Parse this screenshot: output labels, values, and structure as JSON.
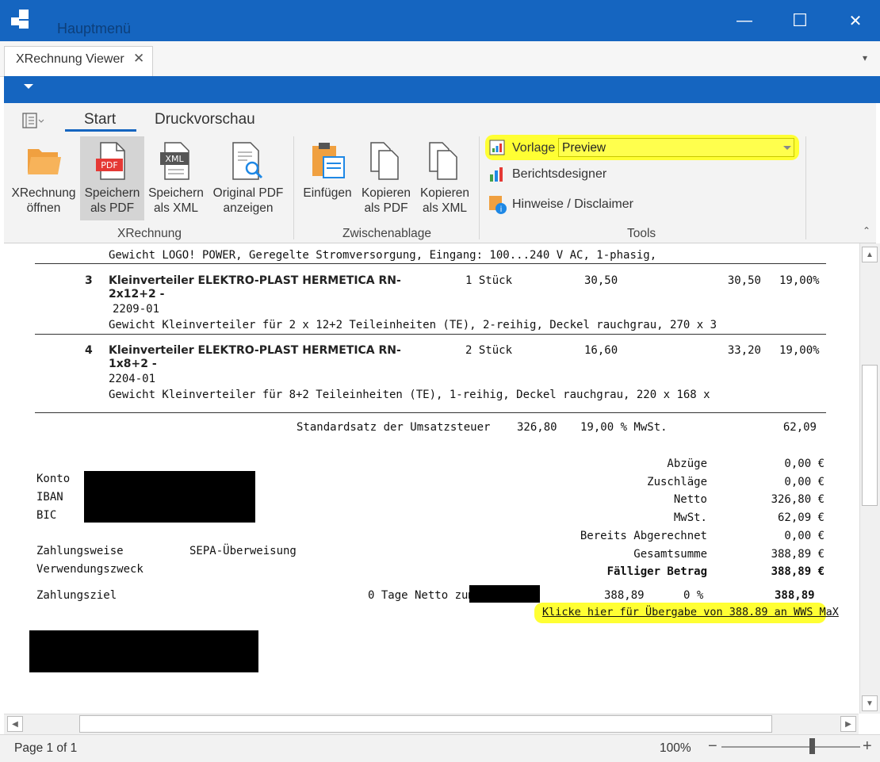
{
  "window": {
    "title": "Hauptmenü",
    "controls": {
      "minimize": "—",
      "maximize": "☐",
      "close": "✕"
    }
  },
  "tab": {
    "label": "XRechnung Viewer",
    "close": "✕",
    "overflow": "▾"
  },
  "ribbon": {
    "tabs": {
      "start": "Start",
      "print_preview": "Druckvorschau"
    },
    "groups": {
      "xrechnung": {
        "label": "XRechnung",
        "buttons": {
          "open": {
            "line1": "XRechnung",
            "line2": "öffnen"
          },
          "save_pdf": {
            "line1": "Speichern",
            "line2": "als PDF"
          },
          "save_xml": {
            "line1": "Speichern",
            "line2": "als XML"
          },
          "show_pdf": {
            "line1": "Original PDF",
            "line2": "anzeigen"
          }
        }
      },
      "clipboard": {
        "label": "Zwischenablage",
        "buttons": {
          "paste": {
            "line1": "Einfügen"
          },
          "copy_pdf": {
            "line1": "Kopieren",
            "line2": "als PDF"
          },
          "copy_xml": {
            "line1": "Kopieren",
            "line2": "als XML"
          }
        }
      },
      "tools": {
        "label": "Tools",
        "template_label": "Vorlage",
        "template_value": "Preview",
        "report_designer": "Berichtsdesigner",
        "notes": "Hinweise / Disclaimer"
      }
    }
  },
  "document": {
    "prev_item_desc": "Gewicht LOGO! POWER, Geregelte Stromversorgung, Eingang: 100...240 V AC, 1-phasig,",
    "items": [
      {
        "pos": "3",
        "title1": "Kleinverteiler ELEKTRO-PLAST HERMETICA RN-",
        "title2": "2x12+2 -",
        "code": "2209-01",
        "qty": "1 Stück",
        "price": "30,50",
        "total": "30,50",
        "vat": "19,00%",
        "desc": "Gewicht Kleinverteiler für 2 x 12+2 Teileinheiten (TE), 2-reihig, Deckel rauchgrau, 270 x 3"
      },
      {
        "pos": "4",
        "title1": "Kleinverteiler ELEKTRO-PLAST HERMETICA RN-",
        "title2": "1x8+2 -",
        "code": "2204-01",
        "qty": "2 Stück",
        "price": "16,60",
        "total": "33,20",
        "vat": "19,00%",
        "desc": "Gewicht Kleinverteiler für 8+2 Teileinheiten (TE), 1-reihig, Deckel rauchgrau, 220 x 168 x"
      }
    ],
    "tax_row": {
      "label": "Standardsatz der Umsatzsteuer",
      "base": "326,80",
      "rate": "19,00 % MwSt.",
      "amount": "62,09"
    },
    "bank": {
      "konto": "Konto",
      "iban": "IBAN",
      "bic": "BIC"
    },
    "payment": {
      "method_label": "Zahlungsweise",
      "method_value": "SEPA-Überweisung",
      "purpose_label": "Verwendungszweck",
      "term_label": "Zahlungsziel",
      "term_text": "0 Tage Netto zum",
      "term_amount": "388,89",
      "term_discount": "0 %",
      "term_total": "388,89"
    },
    "totals": [
      {
        "label": "Abzüge",
        "value": "0,00 €"
      },
      {
        "label": "Zuschläge",
        "value": "0,00 €"
      },
      {
        "label": "Netto",
        "value": "326,80 €"
      },
      {
        "label": "MwSt.",
        "value": "62,09 €"
      },
      {
        "label": "Bereits Abgerechnet",
        "value": "0,00 €"
      },
      {
        "label": "Gesamtsumme",
        "value": "388,89 €"
      },
      {
        "label": "Fälliger Betrag",
        "value": "388,89 €"
      }
    ],
    "transfer_link": "Klicke hier für Übergabe von 388.89 an WWS MaX"
  },
  "status": {
    "page": "Page 1 of 1",
    "zoom": "100%",
    "zoom_minus": "−",
    "zoom_plus": "+",
    "zoom_level": 0.65
  }
}
